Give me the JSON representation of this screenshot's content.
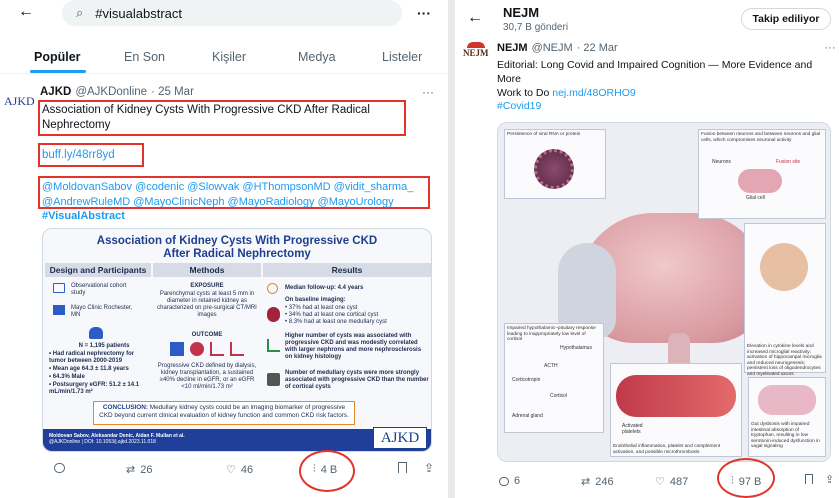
{
  "left": {
    "search": {
      "value": "#visualabstract"
    },
    "tabs": [
      {
        "label": "Popüler"
      },
      {
        "label": "En Son"
      },
      {
        "label": "Kişiler"
      },
      {
        "label": "Medya"
      },
      {
        "label": "Listeler"
      }
    ],
    "tweet": {
      "logo": "AJKD",
      "name": "AJKD",
      "handle": "@AJKDonline",
      "date": "· 25 Mar",
      "text_line1": "Association of Kidney Cysts With Progressive CKD After Radical",
      "text_line2": "Nephrectomy",
      "link": "buff.ly/48rr8yd",
      "mentions_line1": "@MoldovanSabov @codenic @Slowvak @HThompsonMD @vidit_sharma_",
      "mentions_line2": "@AndrewRuleMD @MayoClinicNeph @MayoRadiology @MayoUrology",
      "hashtag": "#VisualAbstract",
      "actions": {
        "retweets": "26",
        "likes": "46",
        "views": "4 B"
      }
    },
    "abstract": {
      "title_line1": "Association of Kidney Cysts With Progressive CKD",
      "title_line2": "After Radical Nephrectomy",
      "col1_head": "Design and Participants",
      "col2_head": "Methods",
      "col3_head": "Results",
      "design1": "Observational cohort study",
      "design2": "Mayo Clinic Rochester, MN",
      "n": "N = 1,195 patients",
      "b1": "• Had radical nephrectomy for tumor between 2000-2019",
      "b2": "• Mean age 64.3 ± 11.8 years",
      "b3": "• 64.3% Male",
      "b4": "• Postsurgery eGFR: 51.2 ± 14.1 mL/min/1.73 m²",
      "exposure_head": "EXPOSURE",
      "exposure": "Parenchymal cysts at least 5 mm in diameter in retained kidney as characterized on pre-surgical CT/MRI images",
      "outcome_head": "OUTCOME",
      "outcome": "Progressive CKD defined by dialysis, kidney transplantation, a sustained ≥40% decline in eGFR, or an eGFR <10 ml/min/1.73 m²",
      "r1": "Median follow-up: 4.4 years",
      "r2": "On baseline imaging:",
      "r2a": "• 37% had at least one cyst",
      "r2b": "• 34% had at least one cortical cyst",
      "r2c": "• 8.3% had at least one medullary cyst",
      "r3": "Higher number of cysts was associated with progressive CKD and was modestly correlated with larger nephrons and more nephrosclerosis on kidney histology",
      "r4": "Number of medullary cysts were more strongly associated with progressive CKD than the number of cortical cysts",
      "conclusion_label": "CONCLUSION:",
      "conclusion": "Medullary kidney cysts could be an imaging biomarker of progressive CKD beyond current clinical evaluation of kidney function and common CKD risk factors.",
      "foot1": "Moldovan Sabov, Aleksandar Denic, Aidan F. Mullan et al.",
      "foot2": "@AJKDonline | DOI: 10.1053/j.ajkd.2023.11.018",
      "logo": "AJKD"
    }
  },
  "right": {
    "header": {
      "name": "NEJM",
      "sub": "30,7 B gönderi",
      "follow": "Takip ediliyor"
    },
    "tweet": {
      "logo": "NEJM",
      "name": "NEJM",
      "handle": "@NEJM",
      "date": "· 22 Mar",
      "text_line1": "Editorial: Long Covid and Impaired Cognition — More Evidence and More",
      "text_line2_a": "Work to Do ",
      "text_line2_link": "nej.md/48ORHO9",
      "hashtag": "#Covid19",
      "actions": {
        "replies": "6",
        "retweets": "246",
        "likes": "487",
        "views": "97 B"
      }
    },
    "figure": {
      "box1": "Persistence of viral RNA or protein",
      "box2": "Fusion between neurons and between neurons and glial cells, which compromises neuronal activity",
      "neurons": "Neurons",
      "fusion": "Fusion site",
      "glial": "Glial cell",
      "box3": "Impaired hypothalamic–pituitary response leading to inappropriately low level of cortisol",
      "hypothalamus": "Hypothalamus",
      "acth": "ACTH",
      "corticotropin": "Corticotropin",
      "cortisol": "Cortisol",
      "adrenal": "Adrenal gland",
      "box4": "Elevation in cytokine levels and increased microglial reactivity; activation of hippocampal microglia and reduced neurogenesis; persistent loss of oligodendrocytes and myelinated axons",
      "box5": "Endothelial inflammation, platelet and complement activation, and possible microthrombosis",
      "platelets": "Activated platelets",
      "box6": "Gut dysbiosis with impaired intestinal absorption of tryptophan, resulting in low serotonin-induced dysfunction in vagal signaling"
    }
  },
  "colors": {
    "accent": "#1d9bf0",
    "highlight": "#e0342c",
    "abstract_blue": "#1d3f8f"
  }
}
